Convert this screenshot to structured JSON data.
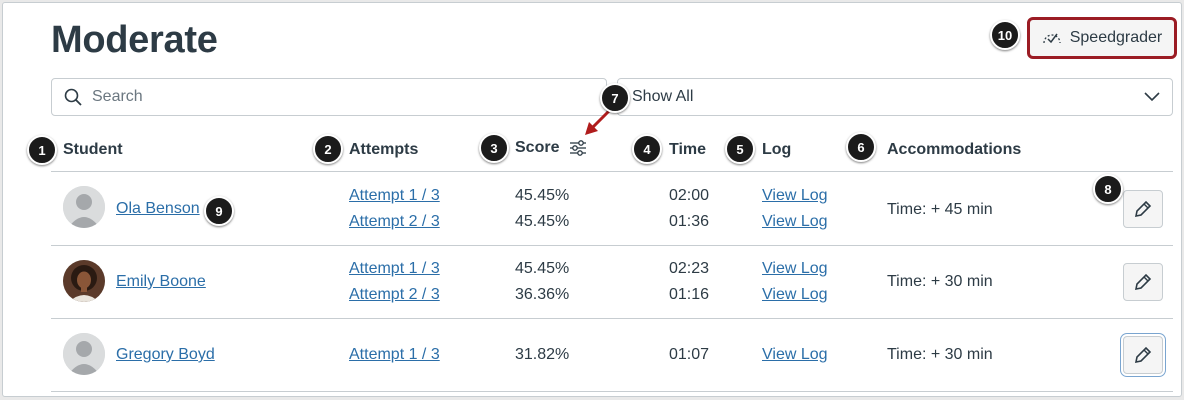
{
  "page": {
    "title": "Moderate"
  },
  "toolbar": {
    "speedgrader_label": "Speedgrader"
  },
  "search": {
    "placeholder": "Search",
    "value": ""
  },
  "filter": {
    "selected": "Show All"
  },
  "table": {
    "headers": {
      "student": "Student",
      "attempts": "Attempts",
      "score": "Score",
      "time": "Time",
      "log": "Log",
      "accommodations": "Accommodations"
    },
    "rows": [
      {
        "name": "Ola Benson",
        "attempts": [
          "Attempt 1 / 3",
          "Attempt 2 / 3"
        ],
        "scores": [
          "45.45%",
          "45.45%"
        ],
        "times": [
          "02:00",
          "01:36"
        ],
        "logs": [
          "View Log",
          "View Log"
        ],
        "accommodation": "Time: + 45 min"
      },
      {
        "name": "Emily Boone",
        "attempts": [
          "Attempt 1 / 3",
          "Attempt 2 / 3"
        ],
        "scores": [
          "45.45%",
          "36.36%"
        ],
        "times": [
          "02:23",
          "01:16"
        ],
        "logs": [
          "View Log",
          "View Log"
        ],
        "accommodation": "Time: + 30 min"
      },
      {
        "name": "Gregory Boyd",
        "attempts": [
          "Attempt 1 / 3"
        ],
        "scores": [
          "31.82%"
        ],
        "times": [
          "01:07"
        ],
        "logs": [
          "View Log"
        ],
        "accommodation": "Time: + 30 min"
      }
    ]
  },
  "callouts": [
    "1",
    "2",
    "3",
    "4",
    "5",
    "6",
    "7",
    "8",
    "9",
    "10"
  ],
  "colors": {
    "link": "#2b6ea8",
    "callout_border": "#9b1c24",
    "callout_badge": "#1b1b1b",
    "arrow": "#b01c1c"
  },
  "icons": {
    "search": "search-icon",
    "speedgrader": "speedgrader-icon",
    "filter": "sliders-icon",
    "dropdown": "chevron-down-icon",
    "edit": "pencil-icon"
  }
}
